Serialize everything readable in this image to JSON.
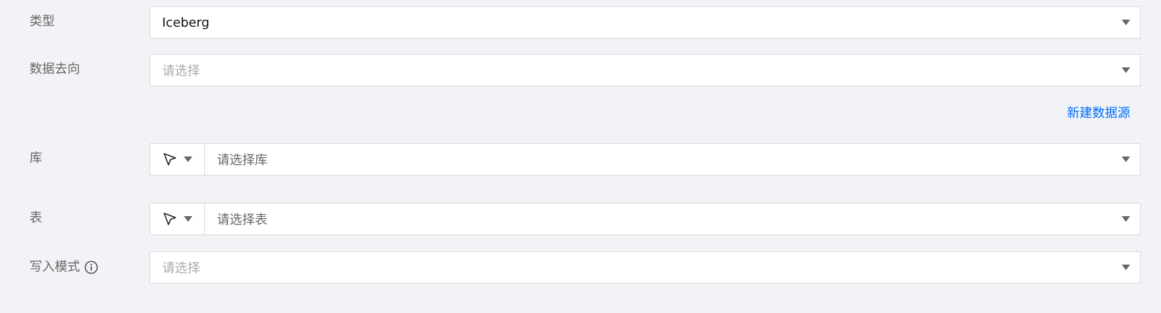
{
  "type": {
    "label": "类型",
    "value": "Iceberg"
  },
  "destination": {
    "label": "数据去向",
    "placeholder": "请选择",
    "new_link": "新建数据源"
  },
  "database": {
    "label": "库",
    "placeholder": "请选择库",
    "mode_icon": "cursor-icon"
  },
  "table": {
    "label": "表",
    "placeholder": "请选择表",
    "mode_icon": "cursor-icon"
  },
  "write_mode": {
    "label": "写入模式",
    "placeholder": "请选择",
    "info_icon": "info-icon"
  },
  "colors": {
    "background": "#f2f3f6",
    "link": "#006eff",
    "border": "#d9d9d9",
    "label": "#666666",
    "placeholder": "#aaaaaa"
  }
}
